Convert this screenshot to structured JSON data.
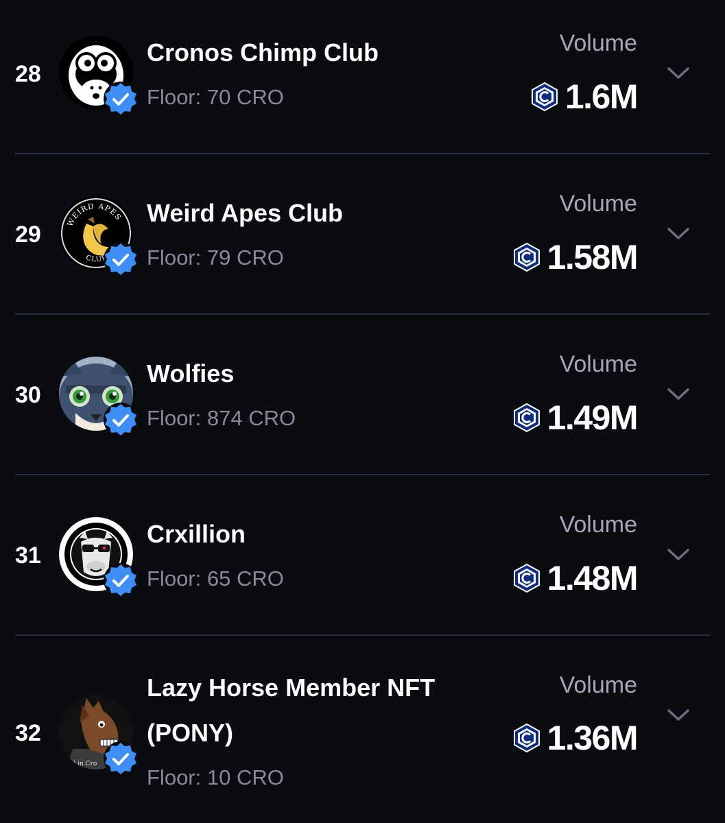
{
  "collections": [
    {
      "rank": "28",
      "name": "Cronos Chimp Club",
      "floor": "Floor: 70 CRO",
      "volume_label": "Volume",
      "volume": "1.6M",
      "avatar_icon": "chimp-avatar-icon",
      "verified": true
    },
    {
      "rank": "29",
      "name": "Weird Apes Club",
      "floor": "Floor: 79 CRO",
      "volume_label": "Volume",
      "volume": "1.58M",
      "avatar_icon": "banana-avatar-icon",
      "verified": true,
      "avatar_text_top": "WEIRD APES",
      "avatar_text_bottom": "CLUB"
    },
    {
      "rank": "30",
      "name": "Wolfies",
      "floor": "Floor: 874 CRO",
      "volume_label": "Volume",
      "volume": "1.49M",
      "avatar_icon": "wolf-avatar-icon",
      "verified": true
    },
    {
      "rank": "31",
      "name": "Crxillion",
      "floor": "Floor: 65 CRO",
      "volume_label": "Volume",
      "volume": "1.48M",
      "avatar_icon": "camel-avatar-icon",
      "verified": true
    },
    {
      "rank": "32",
      "name": "Lazy Horse Member NFT (PONY)",
      "floor": "Floor: 10 CRO",
      "volume_label": "Volume",
      "volume": "1.36M",
      "avatar_icon": "horse-avatar-icon",
      "verified": true,
      "avatar_text": "All in Cro"
    }
  ],
  "colors": {
    "background": "#0b0b12",
    "divider": "#2c2c40",
    "verified_badge": "#3f8ef5",
    "floor_text": "#8a8a96",
    "volume_label": "#a7a7b2",
    "cro_icon": "#0f2d7a"
  }
}
